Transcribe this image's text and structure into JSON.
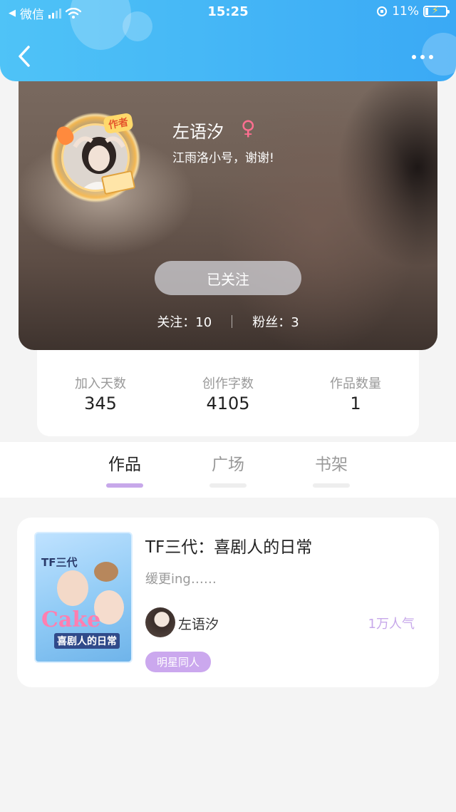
{
  "status": {
    "carrier": "微信",
    "time": "15:25",
    "battery": "11%",
    "battery_level": 0.11
  },
  "nav": {
    "back_icon": "chevron-left-icon",
    "more_icon": "ellipsis-icon"
  },
  "profile": {
    "badge": "作者",
    "name": "左语汐",
    "gender_icon": "♀",
    "signature": "江雨洛小号，谢谢!",
    "follow_button": "已关注",
    "following": "关注：10",
    "followers": "粉丝：3"
  },
  "stats": [
    {
      "label": "加入天数",
      "value": "345"
    },
    {
      "label": "创作字数",
      "value": "4105"
    },
    {
      "label": "作品数量",
      "value": "1"
    }
  ],
  "tabs": [
    {
      "label": "作品",
      "active": true
    },
    {
      "label": "广场",
      "active": false
    },
    {
      "label": "书架",
      "active": false
    }
  ],
  "works": [
    {
      "cover_text_top": "TF三代",
      "cover_text_mid": "Cake",
      "cover_text_bottom": "喜剧人的日常",
      "title": "TF三代：喜剧人的日常",
      "description": "缓更ing……",
      "author": "左语汐",
      "popularity": "1万人气",
      "tag": "明星同人"
    }
  ],
  "colors": {
    "accent_blue": "#3aa9f5",
    "accent_purple": "#c7a8ea",
    "gender_pink": "#ff6f91"
  }
}
